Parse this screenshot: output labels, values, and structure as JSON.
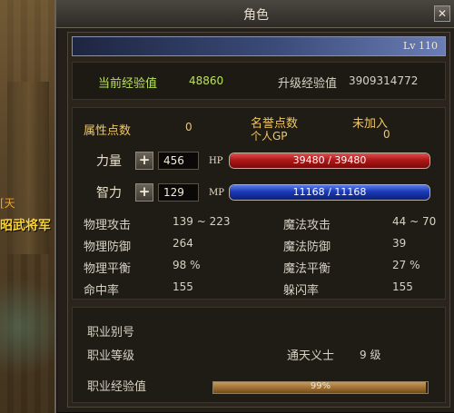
{
  "window": {
    "title": "角色",
    "close_icon": "close-icon"
  },
  "npc": {
    "tag": "[天",
    "name": "昭武将军"
  },
  "level": "Lv 110",
  "exp": {
    "current_label": "当前经验值",
    "current_value": "48860",
    "upgrade_label": "升级经验值",
    "upgrade_value": "3909314772"
  },
  "attr": {
    "points_label": "属性点数",
    "points_value": "0",
    "fame_label": "名誉点数",
    "fame_value": "未加入",
    "gp_label": "个人GP",
    "gp_value": "0",
    "str_label": "力量",
    "str_value": "456",
    "int_label": "智力",
    "int_value": "129",
    "hp_tag": "HP",
    "hp_text": "39480 / 39480",
    "hp_fraction": 1.0,
    "mp_tag": "MP",
    "mp_text": "11168 / 11168",
    "mp_fraction": 1.0
  },
  "stats": [
    {
      "label": "物理攻击",
      "value": "139 ~ 223",
      "label2": "魔法攻击",
      "value2": "44 ~ 70"
    },
    {
      "label": "物理防御",
      "value": "264",
      "label2": "魔法防御",
      "value2": "39"
    },
    {
      "label": "物理平衡",
      "value": "98 %",
      "label2": "魔法平衡",
      "value2": "27 %"
    },
    {
      "label": "命中率",
      "value": "155",
      "label2": "躲闪率",
      "value2": "155"
    }
  ],
  "job": {
    "alias_label": "职业别号",
    "level_label": "职业等级",
    "level_name": "通天义士",
    "level_value": "9 级",
    "exp_label": "职业经验值",
    "exp_text": "99%",
    "exp_fraction": 0.99
  },
  "colors": {
    "hp": "#b01818",
    "mp": "#1a3ab8",
    "job_bar": "#9a6a30"
  }
}
